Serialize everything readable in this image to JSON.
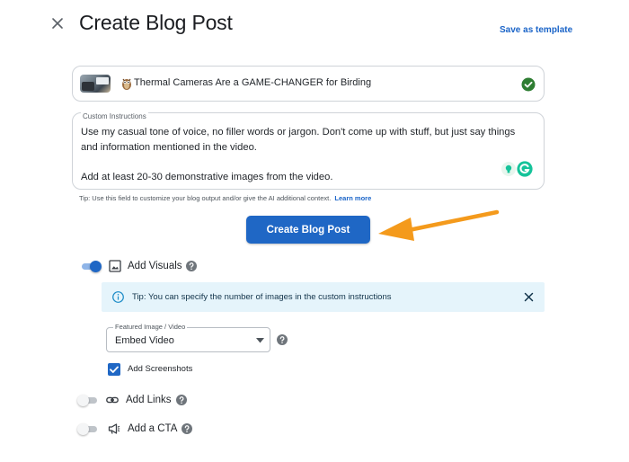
{
  "header": {
    "title": "Create Blog Post",
    "save_template": "Save as template"
  },
  "video": {
    "title": "Thermal Cameras Are a GAME-CHANGER for Birding"
  },
  "instructions": {
    "label": "Custom Instructions",
    "text": "Use my casual tone of voice, no filler words or jargon. Don't come up with stuff, but just say things and information mentioned in the video.\n\nAdd at least 20-30 demonstrative images from the video."
  },
  "tip": {
    "text": "Tip: Use this field to customize your blog output and/or give the AI additional context.",
    "learn_more": "Learn more"
  },
  "create_button": "Create Blog Post",
  "options": {
    "visuals": {
      "label": "Add Visuals",
      "enabled": true
    },
    "links": {
      "label": "Add Links",
      "enabled": false
    },
    "cta": {
      "label": "Add a CTA",
      "enabled": false
    }
  },
  "tip_banner": "Tip: You can specify the number of images in the custom instructions",
  "featured": {
    "label": "Featured Image / Video",
    "value": "Embed Video"
  },
  "screenshots": {
    "label": "Add Screenshots",
    "checked": true
  },
  "colors": {
    "accent": "#1f67c5",
    "link": "#1a64c8",
    "arrow": "#f49a1c",
    "tip_bg": "#e5f4fb",
    "check_green": "#2e7d32"
  }
}
